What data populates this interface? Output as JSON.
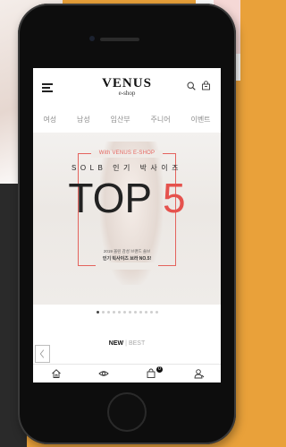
{
  "header": {
    "logo": "VENUS",
    "logo_sub": "e-shop",
    "menu_icon": "hamburger-icon",
    "search_icon": "search-icon",
    "cart_icon": "cart-icon"
  },
  "categories": [
    "여성",
    "남성",
    "임산부",
    "주니어",
    "이벤트"
  ],
  "banner": {
    "tag": "With VENUS E-SHOP",
    "subtitle": "SOLB 인기 박사이즈",
    "top_text": "TOP",
    "top_number": "5",
    "desc_line1": "2019 올린 감성 브랜드 솔브",
    "desc_line2": "인기 빅사이즈 브라 NO.5!",
    "accent_color": "#e5524d"
  },
  "carousel": {
    "total_dots": 12,
    "active_index": 0
  },
  "tabs": {
    "new": "NEW",
    "separator": "|",
    "best": "BEST"
  },
  "bottom_bar": {
    "items": [
      "home-icon",
      "eye-icon",
      "bag-icon",
      "user-icon"
    ],
    "cart_badge": "0"
  }
}
